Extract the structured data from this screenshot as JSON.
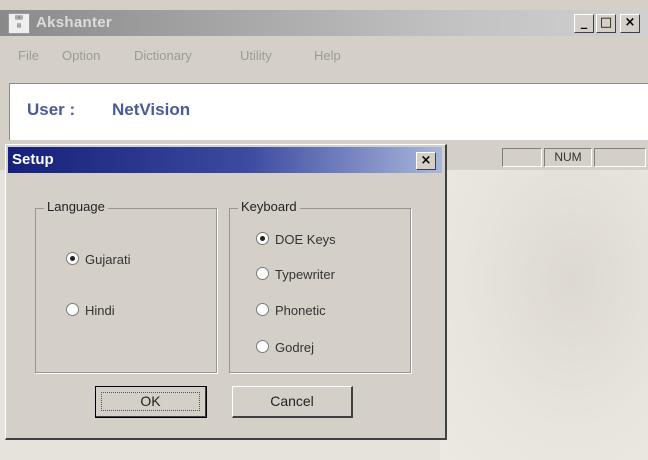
{
  "app": {
    "title": "Akshanter",
    "controls": {
      "minimize": "_",
      "maximize": "□",
      "close": "×"
    },
    "menu": [
      "File",
      "Option",
      "Dictionary",
      "Utility",
      "Help"
    ],
    "user_label": "User :",
    "user_value": "NetVision",
    "status": [
      "",
      "NUM",
      ""
    ]
  },
  "dialog": {
    "title": "Setup",
    "close": "×",
    "language": {
      "label": "Language",
      "options": [
        "Gujarati",
        "Hindi"
      ],
      "selected": "Gujarati"
    },
    "keyboard": {
      "label": "Keyboard",
      "options": [
        "DOE Keys",
        "Typewriter",
        "Phonetic",
        "Godrej"
      ],
      "selected": "DOE Keys"
    },
    "ok_label": "OK",
    "cancel_label": "Cancel"
  }
}
